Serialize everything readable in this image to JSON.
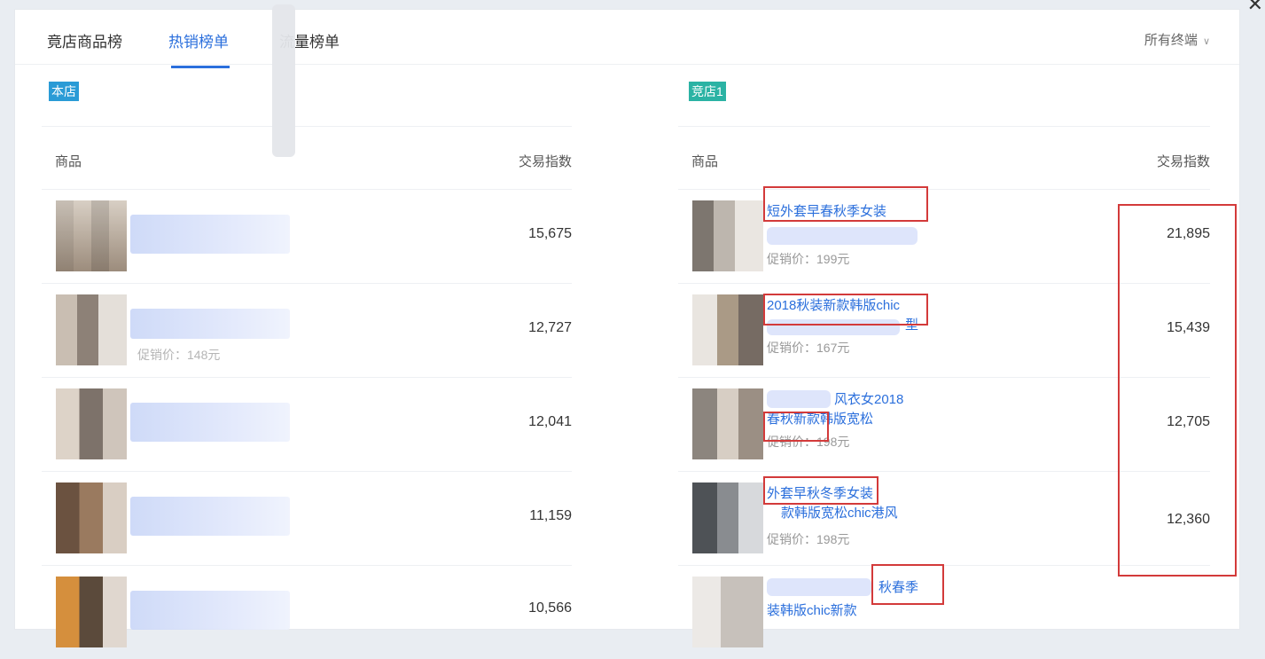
{
  "tabs": [
    {
      "label": "竟店商品榜",
      "active": false
    },
    {
      "label": "热销榜单",
      "active": true
    },
    {
      "label": "流量榜单",
      "active": false
    }
  ],
  "terminal_filter": {
    "label": "所有终端",
    "icon": "chevron-down-icon"
  },
  "close_icon": "close-icon",
  "left": {
    "store_label": "本店",
    "col_item": "商品",
    "col_index": "交易指数",
    "rows": [
      {
        "value": "15,675",
        "price": ""
      },
      {
        "value": "12,727",
        "price": "促销价：148元"
      },
      {
        "value": "12,041",
        "price": ""
      },
      {
        "value": "11,159",
        "price": ""
      },
      {
        "value": "10,566",
        "price": ""
      }
    ]
  },
  "right": {
    "store_label": "竞店1",
    "col_item": "商品",
    "col_index": "交易指数",
    "rows": [
      {
        "title": "短外套早春秋季女装",
        "title2": "",
        "price": "促销价：199元",
        "value": "21,895"
      },
      {
        "title": "2018秋装新款韩版chic",
        "title2": "型",
        "price": "促销价：167元",
        "value": "15,439"
      },
      {
        "title": "风衣女2018",
        "title2": "春秋新款韩版宽松",
        "price": "促销价：198元",
        "value": "12,705"
      },
      {
        "title": "外套早秋冬季女装",
        "title2": "款韩版宽松chic港风",
        "price": "促销价：198元",
        "value": "12,360"
      },
      {
        "title": "秋春季",
        "title2": "装韩版chic新款",
        "price": "",
        "value": ""
      }
    ]
  },
  "colors": {
    "accent": "#2b6fdc",
    "highlight_box": "#d33a3a",
    "store_tag": "#2a9bd6",
    "competitor_tag": "#2bb3a4"
  }
}
